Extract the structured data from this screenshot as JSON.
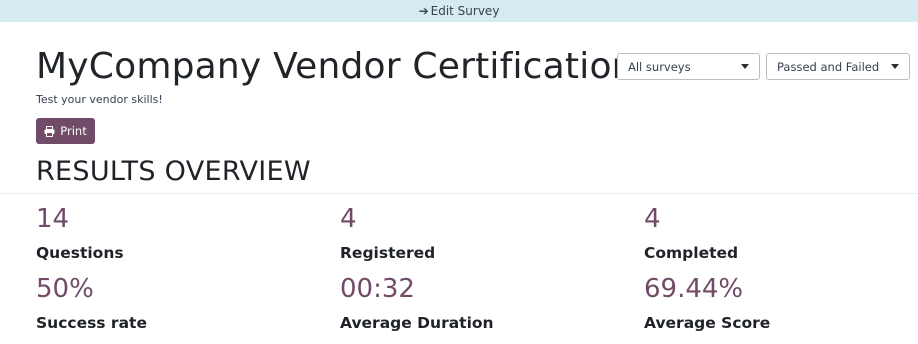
{
  "topbar": {
    "edit_label": "Edit Survey"
  },
  "survey": {
    "title": "MyCompany Vendor Certification",
    "description": "Test your vendor skills!"
  },
  "toolbar": {
    "print_label": "Print"
  },
  "filters": {
    "survey_filter": "All surveys",
    "status_filter": "Passed and Failed"
  },
  "overview": {
    "heading": "RESULTS OVERVIEW",
    "stats": [
      {
        "value": "14",
        "label": "Questions"
      },
      {
        "value": "4",
        "label": "Registered"
      },
      {
        "value": "4",
        "label": "Completed"
      },
      {
        "value": "50%",
        "label": "Success rate"
      },
      {
        "value": "00:32",
        "label": "Average Duration"
      },
      {
        "value": "69.44%",
        "label": "Average Score"
      }
    ]
  },
  "colors": {
    "accent": "#714b67",
    "topbar": "#d6ebf1"
  }
}
